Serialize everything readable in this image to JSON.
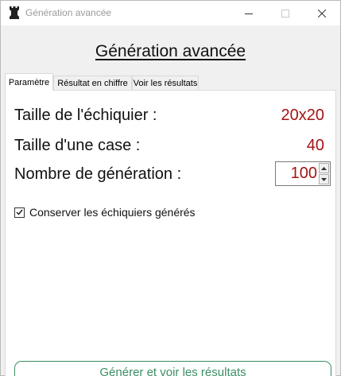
{
  "window": {
    "title": "Génération avancée",
    "icon": "chess-rook-icon"
  },
  "heading": "Génération avancée",
  "tabs": [
    {
      "label": "Paramètre",
      "active": true
    },
    {
      "label": "Résultat en chiffre",
      "active": false
    },
    {
      "label": "Voir les résultats",
      "active": false
    }
  ],
  "params": {
    "board_size_label": "Taille de l'échiquier :",
    "board_size_value": "20x20",
    "cell_size_label": "Taille d'une case :",
    "cell_size_value": "40",
    "generation_label": "Nombre de génération :",
    "generation_value": "100"
  },
  "options": {
    "keep_boards_label": "Conserver les échiquiers générés",
    "keep_boards_checked": true
  },
  "action": {
    "generate_label": "Générer et voir les résultats"
  },
  "colors": {
    "value_red": "#a31515",
    "button_green": "#3b8f63"
  }
}
